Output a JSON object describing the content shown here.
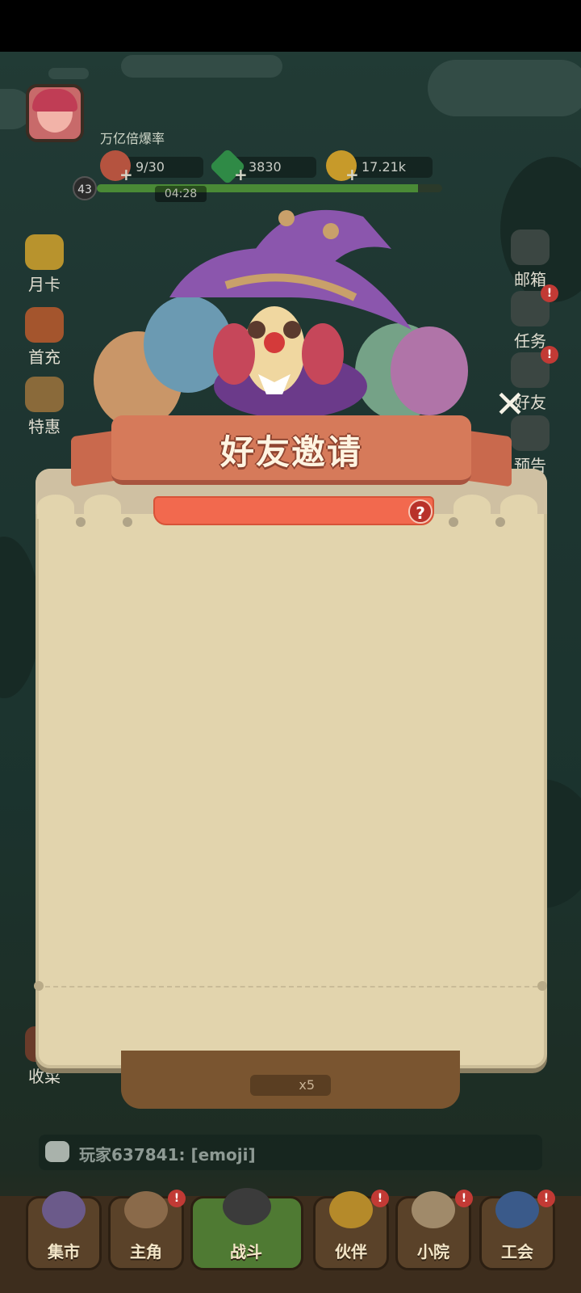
{
  "hud": {
    "player_title": "万亿倍爆率",
    "level": "43",
    "stamina": "9/30",
    "gems": "3830",
    "coins": "17.21k",
    "timer": "04:28",
    "xp_progress": 0.93
  },
  "left_menu": [
    {
      "label": "月卡"
    },
    {
      "label": "首充"
    },
    {
      "label": "特惠"
    }
  ],
  "right_menu": [
    {
      "label": "邮箱"
    },
    {
      "label": "任务"
    },
    {
      "label": "好友"
    },
    {
      "label": "预告"
    }
  ],
  "harvest_label": "收菜",
  "modal": {
    "title": "好友邀请",
    "help_icon": "?",
    "close_icon": "✕"
  },
  "reward_count": "x5",
  "chat": {
    "message": "玩家637841: [emoji]"
  },
  "bottom_nav": [
    {
      "label": "集市",
      "icon": "wizard-cat-icon",
      "badge": false
    },
    {
      "label": "主角",
      "icon": "hero-icon",
      "badge": true
    },
    {
      "label": "战斗",
      "icon": "pickaxe-shovel-icon",
      "badge": false
    },
    {
      "label": "伙伴",
      "icon": "sunflower-icon",
      "badge": true
    },
    {
      "label": "小院",
      "icon": "castle-icon",
      "badge": true
    },
    {
      "label": "工会",
      "icon": "shield-icon",
      "badge": true
    }
  ],
  "badge_mark": "!",
  "colors": {
    "modal_bg": "#e2d4ad",
    "banner": "#d67a5a",
    "accent_red": "#f2694e",
    "nav_active": "#4f7a33"
  }
}
